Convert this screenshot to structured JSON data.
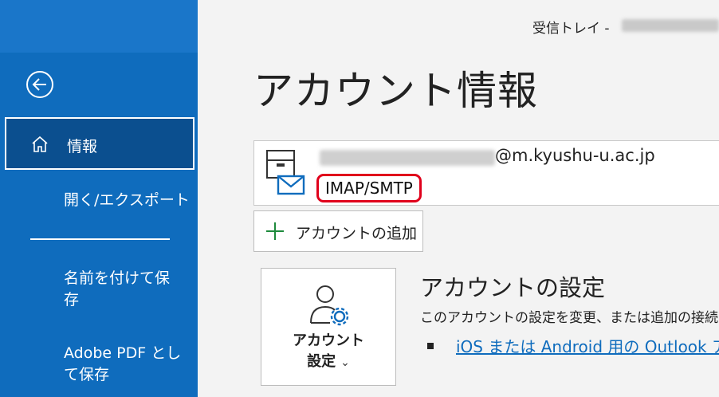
{
  "window": {
    "title": "受信トレイ -"
  },
  "sidebar": {
    "back_icon": "back-arrow-circle-icon",
    "items": [
      {
        "label": "情報",
        "icon": "home-icon",
        "selected": true
      },
      {
        "label": "開く/エクスポート"
      },
      {
        "label": "名前を付けて保存"
      },
      {
        "label": "Adobe PDF として保存"
      }
    ]
  },
  "page": {
    "title": "アカウント情報"
  },
  "account": {
    "email_domain": "@m.kyushu-u.ac.jp",
    "protocol": "IMAP/SMTP",
    "icon": "mail-account-icon"
  },
  "add_account": {
    "label": "アカウントの追加",
    "icon": "plus-icon"
  },
  "account_settings": {
    "button_line1": "アカウント",
    "button_line2": "設定",
    "chevron": "⌄",
    "title": "アカウントの設定",
    "description": "このアカウントの設定を変更、または追加の接続",
    "link": "iOS または Android 用の Outlook ア"
  },
  "colors": {
    "sidebar": "#0f6cbd",
    "highlight": "#e0001b",
    "link": "#0f6cbd"
  }
}
